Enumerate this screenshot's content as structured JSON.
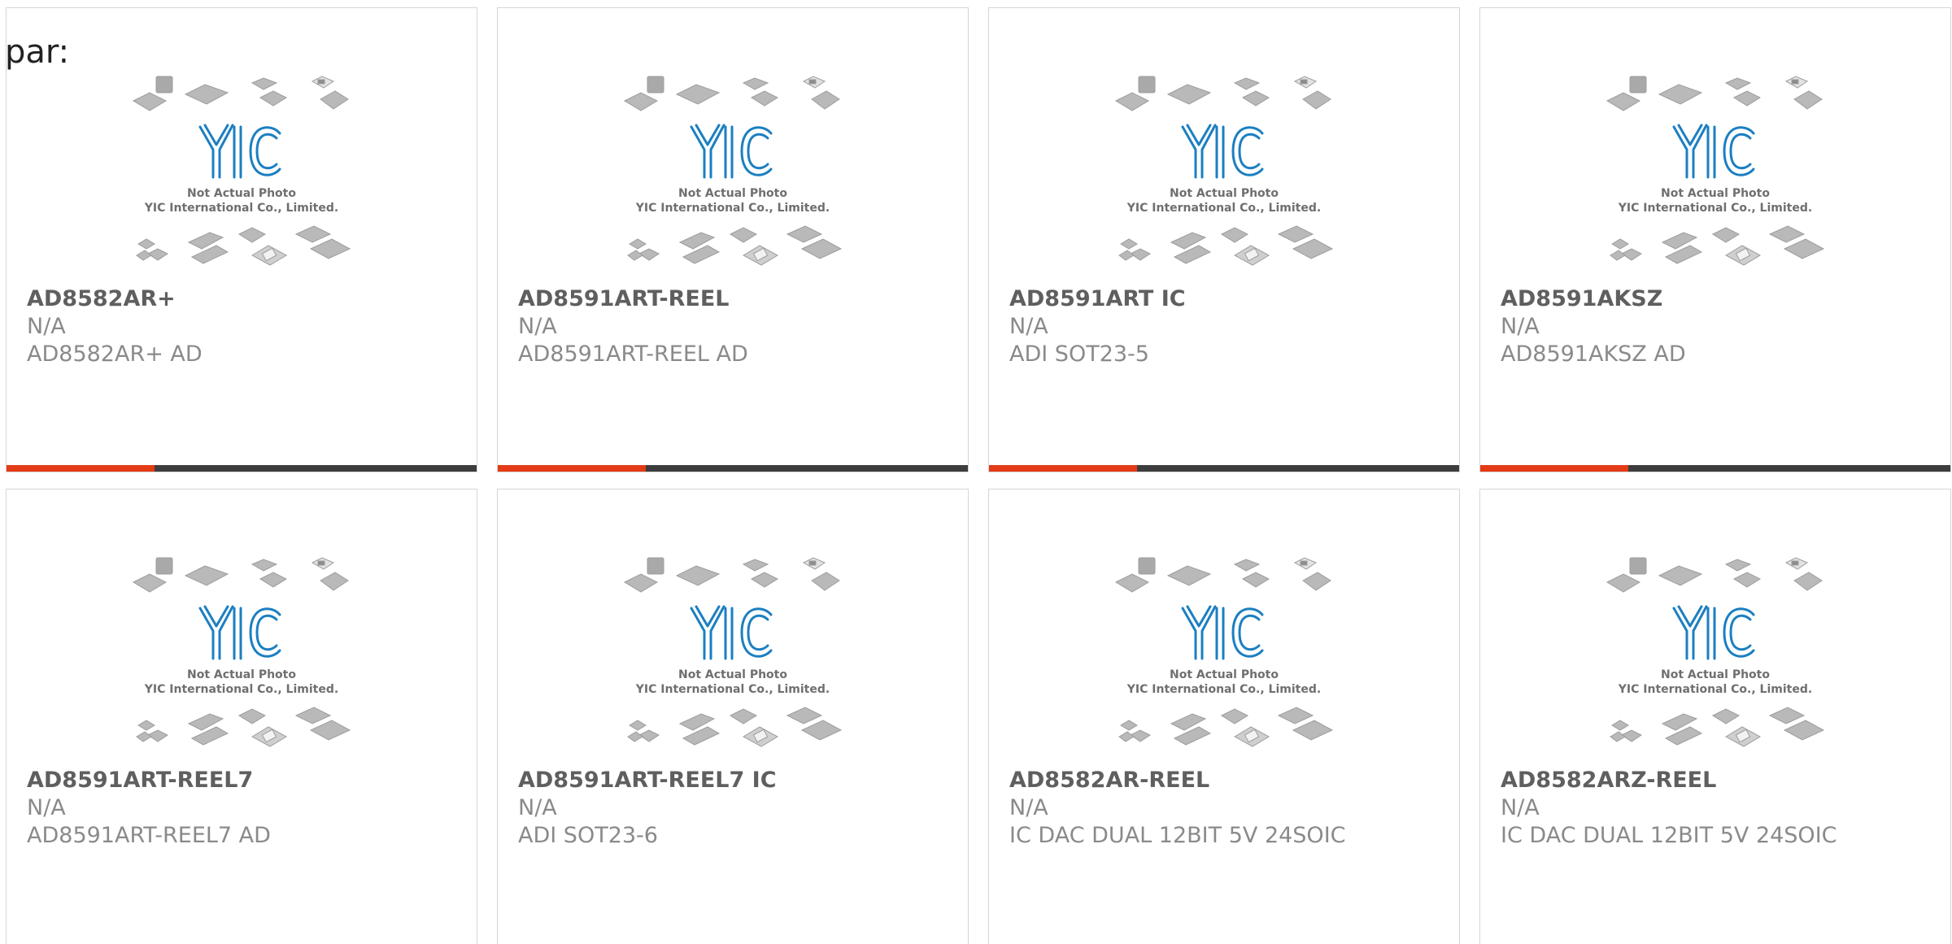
{
  "header": {
    "label": "par:"
  },
  "placeholder_image": {
    "logo": "YIC",
    "line1": "Not Actual Photo",
    "line2": "YIC International Co., Limited."
  },
  "colors": {
    "accent": "#e33b16",
    "bar": "#3d3d3d",
    "logo": "#1a7fc0"
  },
  "products": [
    {
      "name": "AD8582AR+",
      "line1": "N/A",
      "line2": "AD8582AR+ AD",
      "has_bar": true
    },
    {
      "name": "AD8591ART-REEL",
      "line1": "N/A",
      "line2": "AD8591ART-REEL AD",
      "has_bar": true
    },
    {
      "name": "AD8591ART IC",
      "line1": "N/A",
      "line2": "ADI SOT23-5",
      "has_bar": true
    },
    {
      "name": "AD8591AKSZ",
      "line1": "N/A",
      "line2": "AD8591AKSZ AD",
      "has_bar": true
    },
    {
      "name": "AD8591ART-REEL7",
      "line1": "N/A",
      "line2": "AD8591ART-REEL7 AD",
      "has_bar": false
    },
    {
      "name": "AD8591ART-REEL7 IC",
      "line1": "N/A",
      "line2": "ADI SOT23-6",
      "has_bar": false
    },
    {
      "name": "AD8582AR-REEL",
      "line1": "N/A",
      "line2": "IC DAC DUAL 12BIT 5V 24SOIC",
      "has_bar": false
    },
    {
      "name": "AD8582ARZ-REEL",
      "line1": "N/A",
      "line2": "IC DAC DUAL 12BIT 5V 24SOIC",
      "has_bar": false
    }
  ]
}
